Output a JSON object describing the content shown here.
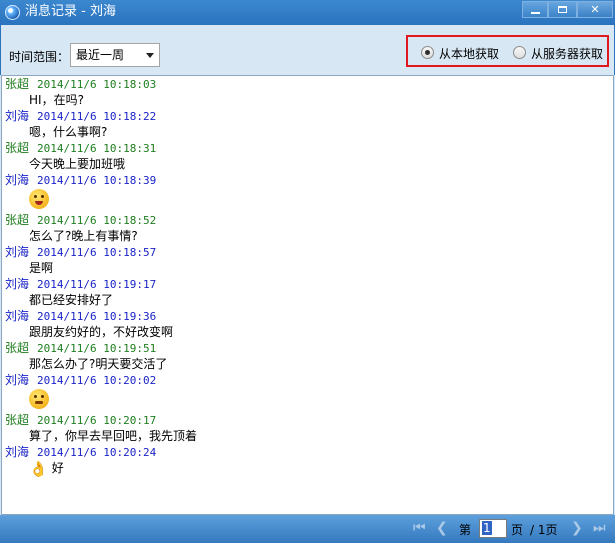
{
  "window": {
    "title": "消息记录 - 刘海"
  },
  "toolbar": {
    "range_label": "时间范围：",
    "range_value": "最近一周",
    "sources": [
      {
        "label": "从本地获取",
        "checked": true
      },
      {
        "label": "从服务器获取",
        "checked": false
      }
    ]
  },
  "colors": {
    "sender_self": "#1e7d1e",
    "sender_other": "#1a23c8",
    "highlight_border": "#e0191e"
  },
  "messages": [
    {
      "sender": "张超",
      "time": "2014/11/6 10:18:03",
      "text": "HI，在吗?"
    },
    {
      "sender": "刘海",
      "time": "2014/11/6 10:18:22",
      "text": "嗯，什么事啊?"
    },
    {
      "sender": "张超",
      "time": "2014/11/6 10:18:31",
      "text": "今天晚上要加班哦"
    },
    {
      "sender": "刘海",
      "time": "2014/11/6 10:18:39",
      "text": "",
      "emoji": "crying-face-icon"
    },
    {
      "sender": "张超",
      "time": "2014/11/6 10:18:52",
      "text": "怎么了?晚上有事情?"
    },
    {
      "sender": "刘海",
      "time": "2014/11/6 10:18:57",
      "text": "是啊"
    },
    {
      "sender": "刘海",
      "time": "2014/11/6 10:19:17",
      "text": "都已经安排好了"
    },
    {
      "sender": "刘海",
      "time": "2014/11/6 10:19:36",
      "text": "跟朋友约好的，不好改变啊"
    },
    {
      "sender": "张超",
      "time": "2014/11/6 10:19:51",
      "text": "那怎么办了?明天要交活了"
    },
    {
      "sender": "刘海",
      "time": "2014/11/6 10:20:02",
      "text": "",
      "emoji": "frustrated-face-icon"
    },
    {
      "sender": "张超",
      "time": "2014/11/6 10:20:17",
      "text": "算了，你早去早回吧，我先顶着"
    },
    {
      "sender": "刘海",
      "time": "2014/11/6 10:20:24",
      "text": "好",
      "emoji": "ok-hand-icon"
    }
  ],
  "pager": {
    "prefix": "第",
    "current": "1",
    "suffix": "页",
    "total": "/ 1页"
  }
}
